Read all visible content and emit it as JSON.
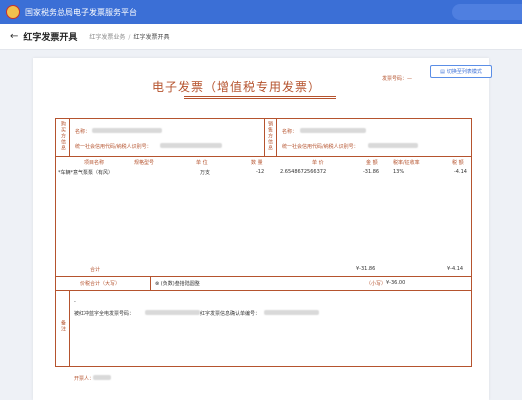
{
  "app": {
    "title": "国家税务总局电子发票服务平台"
  },
  "header": {
    "back_label": "←",
    "page_title": "红字发票开具",
    "breadcrumb": [
      "红字发票业务",
      "红字发票开具"
    ]
  },
  "invoice": {
    "title": "电子发票（增值税专用发票）",
    "number_label": "发票号码：",
    "number_value": "—",
    "switch_button": "切换至列表模式",
    "buyer_label": "购买方信息",
    "seller_label": "销售方信息",
    "name_label": "名称：",
    "taxid_label": "统一社会信用代码/纳税人识别号：",
    "columns": [
      "项目名称",
      "规格型号",
      "单 位",
      "数 量",
      "单 价",
      "金 额",
      "税率/征收率",
      "税 额"
    ],
    "items": [
      {
        "name": "*车辆*意气泵泵（有风）",
        "spec": "",
        "unit": "万支",
        "qty": "-12",
        "price": "2.6548672566372",
        "amount": "-31.86",
        "rate": "13%",
        "tax": "-4.14"
      }
    ],
    "total_label": "合计",
    "total_amount": "¥-31.86",
    "total_tax": "¥-4.14",
    "in_words_label": "价税合计（大写）",
    "in_words_value": "(负数)叁拾陆圆整",
    "in_figures_label": "（小写）",
    "in_figures_value": "¥-36.00",
    "remark_label": "备注",
    "remark_text": "被红冲蓝字全电发票号码：",
    "remark_text2": "红字发票信息确认单编号：",
    "drawer_label": "开票人："
  }
}
